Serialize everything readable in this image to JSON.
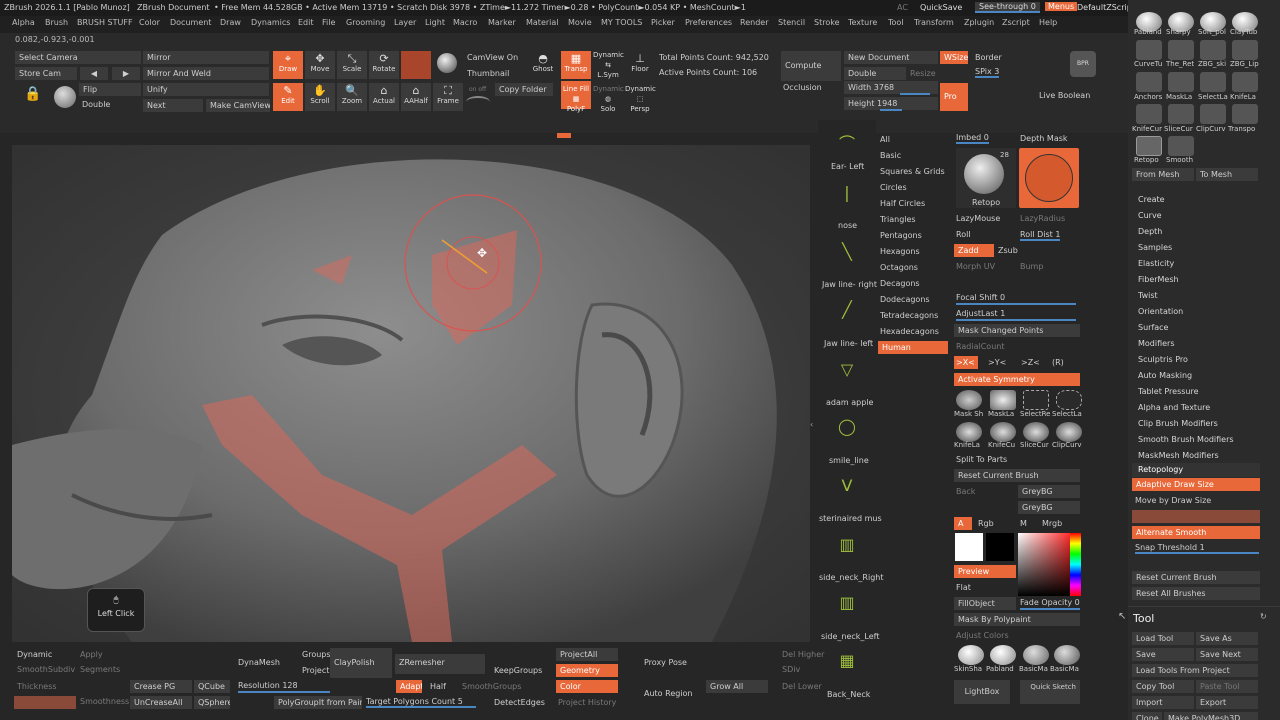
{
  "titlebar": {
    "app": "ZBrush 2026.1.1 [Pablo Munoz]",
    "doc": "ZBrush Document",
    "stats": "• Free Mem 44.528GB • Active Mem 13719 • Scratch Disk 3978 • ZTime►11.272 Timer►0.28 • PolyCount►0.054 KP • MeshCount►1",
    "ac": "AC",
    "quicksave": "QuickSave",
    "seethrough": "See-through 0",
    "menus": "Menus",
    "script": "DefaultZScript"
  },
  "menu": [
    "Alpha",
    "Brush",
    "BRUSH STUFF",
    "Color",
    "Document",
    "Draw",
    "Dynamics",
    "Edit",
    "File",
    "Grooming",
    "Layer",
    "Light",
    "Macro",
    "Marker",
    "Material",
    "Movie",
    "MY TOOLS",
    "Picker",
    "Preferences",
    "Render",
    "Stencil",
    "Stroke",
    "Texture",
    "Tool",
    "Transform",
    "Zplugin",
    "Zscript",
    "Help"
  ],
  "coords": "0.082,-0.923,-0.001",
  "shelf": {
    "select_camera": "Select Camera",
    "store_cam": "Store Cam",
    "mirror": "Mirror",
    "mirror_weld": "Mirror And Weld",
    "flip": "Flip",
    "unify": "Unify",
    "double": "Double",
    "next": "Next",
    "make_camview": "Make CamView",
    "draw": "Draw",
    "move": "Move",
    "scale": "Scale",
    "rotate": "Rotate",
    "edit": "Edit",
    "scroll": "Scroll",
    "zoom": "Zoom",
    "actual": "Actual",
    "aahalf": "AAHalf",
    "frame": "Frame",
    "camview_on": "CamView On",
    "thumbnail": "Thumbnail",
    "copy_folder": "Copy Folder",
    "on_off": "on  off",
    "ghost": "Ghost",
    "transp": "Transp",
    "dynamic": "Dynamic",
    "lsym": "L.Sym",
    "floor": "Floor",
    "linefill": "Line Fill",
    "polyf": "PolyF",
    "solo": "Solo",
    "persp": "Persp",
    "total_points": "Total Points Count: 942,520",
    "active_points": "Active Points Count: 106",
    "compute": "Compute",
    "occlusion": "Occlusion",
    "new_document": "New Document",
    "wsize": "WSize",
    "border": "Border",
    "double2": "Double",
    "resize": "Resize",
    "spix": "SPix 3",
    "width": "Width 3768",
    "height": "Height 1948",
    "pro": "Pro",
    "bpr": "BPR",
    "live_boolean": "Live Boolean"
  },
  "viewport": {
    "left_click": "Left Click"
  },
  "alphas": [
    "Ear- Left",
    "nose",
    "Jaw line- right",
    "Jaw line- left",
    "adam apple",
    "smile_line",
    "sterinaired mus",
    "side_neck_Right",
    "side_neck_Left",
    "Back_Neck"
  ],
  "categories": [
    "All",
    "Basic",
    "Squares & Grids",
    "Circles",
    "Half Circles",
    "Triangles",
    "Pentagons",
    "Hexagons",
    "Octagons",
    "Decagons",
    "Dodecagons",
    "Tetradecagons",
    "Hexadecagons",
    "Human"
  ],
  "brushpanel": {
    "imbed": "Imbed 0",
    "depth_mask": "Depth Mask",
    "retopo": "Retopo",
    "num28": "28",
    "lazymouse": "LazyMouse",
    "lazyradius": "LazyRadius",
    "roll": "Roll",
    "roll_dist": "Roll Dist 1",
    "zadd": "Zadd",
    "zsub": "Zsub",
    "morph_uv": "Morph UV",
    "bump": "Bump",
    "focal_shift": "Focal Shift 0",
    "adjustlast": "AdjustLast 1",
    "mask_changed": "Mask Changed Points",
    "radialcount": "RadialCount",
    "sym_x": ">X<",
    ">sym_y": ">Y<",
    "sym_y": ">Y<",
    "sym_z": ">Z<",
    "sym_r": "(R)",
    "activate_symmetry": "Activate Symmetry",
    "b1": "Mask Sh",
    "b2": "MaskLa",
    "b3": "SelectRe",
    "b4": "SelectLa",
    "b5": "KnifeLa",
    "b6": "KnifeCu",
    "b7": "SliceCur",
    "b8": "ClipCurv",
    "split_parts": "Split To Parts",
    "reset_brush": "Reset Current Brush",
    "back": "Back",
    "greybg1": "GreyBG",
    "greybg2": "GreyBG",
    "a": "A",
    "rgb": "Rgb",
    "m": "M",
    "mrgb": "Mrgb",
    "preview": "Preview",
    "flat": "Flat",
    "fillobject": "FillObject",
    "fade_opacity": "Fade Opacity 0",
    "mask_polypaint": "Mask By Polypaint",
    "adjust_colors": "Adjust Colors",
    "m1": "SkinSha",
    "m2": "Pabland",
    "m3": "BasicMa",
    "m4": "BasicMa",
    "lightbox": "LightBox",
    "quicksketch": "Quick Sketch"
  },
  "rightpanel": {
    "brushes": [
      "Pabland",
      "Sharpy",
      "Soft_pol",
      "ClayTub",
      "CurveTu",
      "The_Ret",
      "ZBG_ski",
      "ZBG_Lip",
      "Anchors",
      "MaskLa",
      "SelectLa",
      "KnifeLa",
      "KnifeCur",
      "SliceCur",
      "ClipCurv",
      "Transpo",
      "Retopo",
      "Smooth"
    ],
    "from_mesh": "From Mesh",
    "to_mesh": "To Mesh",
    "items": [
      "Create",
      "Curve",
      "Depth",
      "Samples",
      "Elasticity",
      "FiberMesh",
      "Twist",
      "Orientation",
      "Surface",
      "Modifiers",
      "Sculptris Pro",
      "Auto Masking",
      "Tablet Pressure",
      "Alpha and Texture",
      "Clip Brush Modifiers",
      "Smooth Brush Modifiers",
      "MaskMesh Modifiers",
      "Retopology"
    ],
    "adaptive_draw": "Adaptive Draw Size",
    "move_by_draw": "Move by Draw Size",
    "alternate_smooth": "Alternate Smooth",
    "snap_threshold": "Snap Threshold 1",
    "reset_current": "Reset Current Brush",
    "reset_all": "Reset All Brushes",
    "tool_title": "Tool",
    "load_tool": "Load Tool",
    "save_as": "Save As",
    "save": "Save",
    "save_next": "Save Next",
    "load_from_project": "Load Tools From Project",
    "copy_tool": "Copy Tool",
    "paste_tool": "Paste Tool",
    "import": "Import",
    "export": "Export",
    "clone": "Clone",
    "make_polymesh": "Make PolyMesh3D"
  },
  "bottom": {
    "dynamic": "Dynamic",
    "apply": "Apply",
    "smoothsubdiv": "SmoothSubdiv",
    "segments": "Segments",
    "thickness": "Thickness",
    "smoothness": "Smoothness",
    "crease_pg": "Crease PG",
    "qcube": "QCube",
    "uncreaseall": "UnCreaseAll",
    "qsphere": "QSphere",
    "dynamesh": "DynaMesh",
    "groups": "Groups",
    "project": "Project",
    "claypolish": "ClayPolish",
    "resolution": "Resolution 128",
    "polygroupit": "PolyGroupIt from Paint",
    "zremesher": "ZRemesher",
    "adapt": "Adapt",
    "half": "Half",
    "smoothgroups": "SmoothGroups",
    "target_polys": "Target Polygons Count 5",
    "keepgroups": "KeepGroups",
    "detectedges": "DetectEdges",
    "projectall": "ProjectAll",
    "geometry": "Geometry",
    "color": "Color",
    "project_history": "Project History",
    "proxy_pose": "Proxy Pose",
    "auto_region": "Auto Region",
    "grow_all": "Grow All",
    "del_higher": "Del Higher",
    "sdiv": "SDiv",
    "del_lower": "Del Lower"
  }
}
